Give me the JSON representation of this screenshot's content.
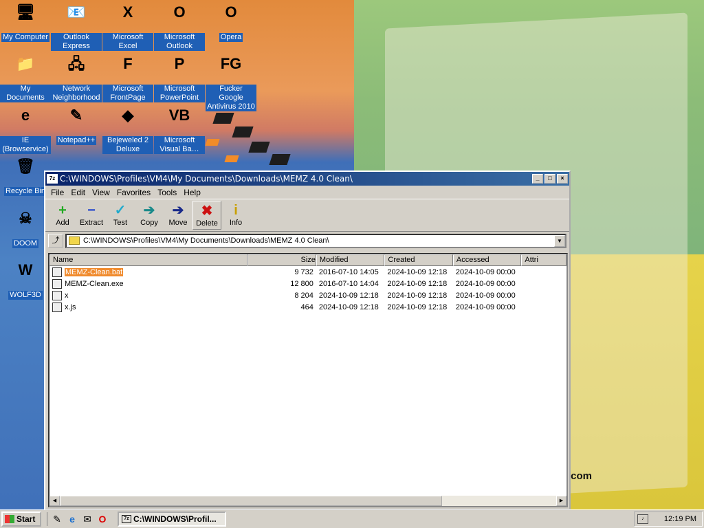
{
  "desktop": {
    "icons": [
      {
        "label": "My Computer",
        "icon": "computer-icon",
        "glyph": "🖥"
      },
      {
        "label": "Outlook Express",
        "icon": "outlook-express-icon",
        "glyph": "📧"
      },
      {
        "label": "Microsoft Excel",
        "icon": "excel-icon",
        "glyph": "X"
      },
      {
        "label": "Microsoft Outlook",
        "icon": "outlook-icon",
        "glyph": "O"
      },
      {
        "label": "Opera",
        "icon": "opera-icon",
        "glyph": "O"
      },
      {
        "label": "My Documents",
        "icon": "folder-icon",
        "glyph": "📁"
      },
      {
        "label": "Network Neighborhood",
        "icon": "network-icon",
        "glyph": "🖧"
      },
      {
        "label": "Microsoft FrontPage",
        "icon": "frontpage-icon",
        "glyph": "F"
      },
      {
        "label": "Microsoft PowerPoint",
        "icon": "powerpoint-icon",
        "glyph": "P"
      },
      {
        "label": "Fucker Google Antivirus 2010",
        "icon": "antivirus-icon",
        "glyph": "FG"
      },
      {
        "label": "IE (Browservice)",
        "icon": "ie-icon",
        "glyph": "e"
      },
      {
        "label": "Notepad++",
        "icon": "notepad-icon",
        "glyph": "✎"
      },
      {
        "label": "Bejeweled 2 Deluxe",
        "icon": "bejeweled-icon",
        "glyph": "◆"
      },
      {
        "label": "Microsoft Visual Ba…",
        "icon": "visual-basic-icon",
        "glyph": "VB"
      },
      {
        "label": "Recycle Bin",
        "icon": "recycle-bin-icon",
        "glyph": "🗑"
      },
      {
        "label": "DOOM",
        "icon": "doom-icon",
        "glyph": "☠"
      },
      {
        "label": "WOLF3D",
        "icon": "wolf3d-icon",
        "glyph": "W"
      }
    ],
    "watermark": ".com"
  },
  "window": {
    "title": "C:\\WINDOWS\\Profiles\\VM4\\My Documents\\Downloads\\MEMZ 4.0 Clean\\",
    "app_icon": "7z",
    "menu": [
      "File",
      "Edit",
      "View",
      "Favorites",
      "Tools",
      "Help"
    ],
    "toolbar": [
      {
        "label": "Add",
        "glyph": "+",
        "color": "#22aa22"
      },
      {
        "label": "Extract",
        "glyph": "−",
        "color": "#2244cc"
      },
      {
        "label": "Test",
        "glyph": "✓",
        "color": "#22aacc"
      },
      {
        "label": "Copy",
        "glyph": "➔",
        "color": "#1a8a8a"
      },
      {
        "label": "Move",
        "glyph": "➔",
        "color": "#1a2a8a"
      },
      {
        "label": "Delete",
        "glyph": "✖",
        "color": "#cc1111"
      },
      {
        "label": "Info",
        "glyph": "i",
        "color": "#c8a000"
      }
    ],
    "address": "C:\\WINDOWS\\Profiles\\VM4\\My Documents\\Downloads\\MEMZ 4.0 Clean\\",
    "columns": [
      "Name",
      "Size",
      "Modified",
      "Created",
      "Accessed",
      "Attri"
    ],
    "files": [
      {
        "name": "MEMZ-Clean.bat",
        "size": "9 732",
        "modified": "2016-07-10 14:05",
        "created": "2024-10-09 12:18",
        "accessed": "2024-10-09 00:00",
        "selected": true
      },
      {
        "name": "MEMZ-Clean.exe",
        "size": "12 800",
        "modified": "2016-07-10 14:04",
        "created": "2024-10-09 12:18",
        "accessed": "2024-10-09 00:00",
        "selected": false
      },
      {
        "name": "x",
        "size": "8 204",
        "modified": "2024-10-09 12:18",
        "created": "2024-10-09 12:18",
        "accessed": "2024-10-09 00:00",
        "selected": false
      },
      {
        "name": "x.js",
        "size": "464",
        "modified": "2024-10-09 12:18",
        "created": "2024-10-09 12:18",
        "accessed": "2024-10-09 00:00",
        "selected": false
      }
    ]
  },
  "taskbar": {
    "start_label": "Start",
    "task_label": "C:\\WINDOWS\\Profil...",
    "clock": "12:19 PM"
  }
}
